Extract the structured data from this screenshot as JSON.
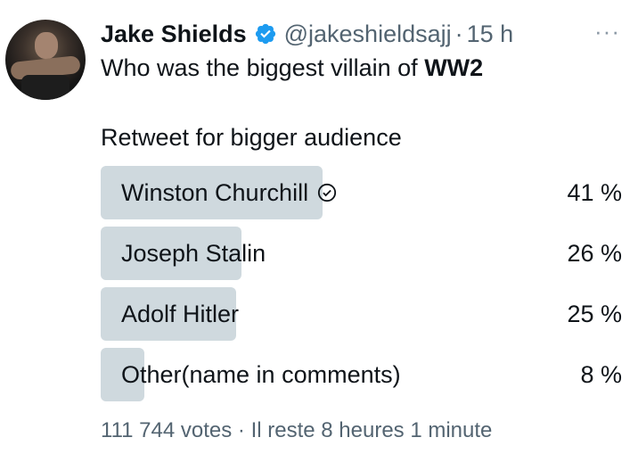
{
  "author": {
    "name": "Jake Shields",
    "handle": "@jakeshieldsajj",
    "separator": "·",
    "time": "15 h",
    "more_icon": "more-horizontal-icon",
    "verified_color": "#1d9bf0"
  },
  "tweet": {
    "text_prefix": "Who was the biggest villain of ",
    "text_bold": "WW2",
    "text_line2": "Retweet for bigger audience"
  },
  "poll": {
    "bar_color": "#cfd9de",
    "options": [
      {
        "label": "Winston Churchill",
        "percent": "41 %",
        "value": 41,
        "selected": true
      },
      {
        "label": "Joseph Stalin",
        "percent": "26 %",
        "value": 26,
        "selected": false
      },
      {
        "label": "Adolf Hitler",
        "percent": "25 %",
        "value": 25,
        "selected": false
      },
      {
        "label": "Other(name in comments)",
        "percent": "8 %",
        "value": 8,
        "selected": false
      }
    ],
    "votes": "111 744 votes",
    "separator": "·",
    "remaining": "Il reste 8 heures 1 minute"
  }
}
